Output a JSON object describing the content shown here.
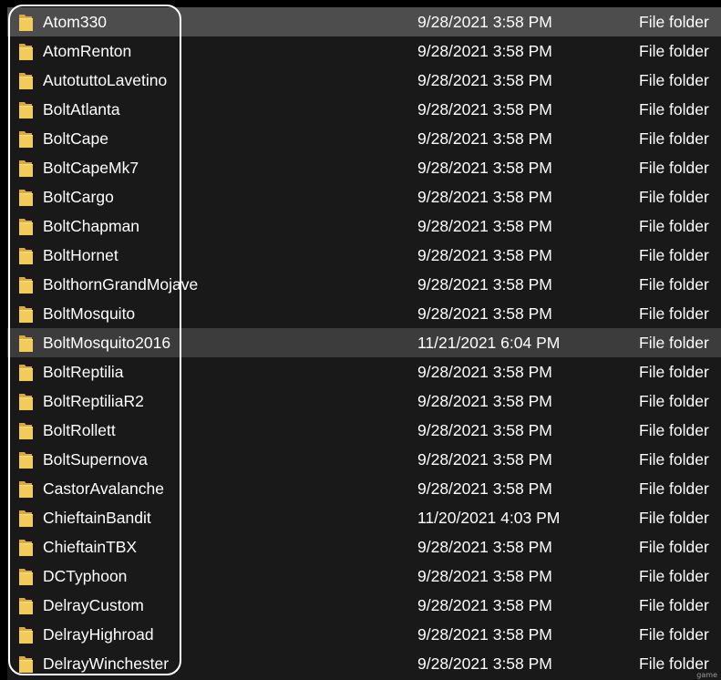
{
  "file_list": {
    "icon": "folder-icon",
    "colors": {
      "background": "#191919",
      "selected_row": "#4d4d4d",
      "hovered_row": "#3c3c3c",
      "text": "#ffffff",
      "folder_yellow": "#f3cb5b",
      "highlight_border": "#ffffff"
    },
    "rows": [
      {
        "name": "Atom330",
        "date": "9/28/2021 3:58 PM",
        "type": "File folder",
        "state": "selected"
      },
      {
        "name": "AtomRenton",
        "date": "9/28/2021 3:58 PM",
        "type": "File folder",
        "state": ""
      },
      {
        "name": "AutotuttoLavetino",
        "date": "9/28/2021 3:58 PM",
        "type": "File folder",
        "state": ""
      },
      {
        "name": "BoltAtlanta",
        "date": "9/28/2021 3:58 PM",
        "type": "File folder",
        "state": ""
      },
      {
        "name": "BoltCape",
        "date": "9/28/2021 3:58 PM",
        "type": "File folder",
        "state": ""
      },
      {
        "name": "BoltCapeMk7",
        "date": "9/28/2021 3:58 PM",
        "type": "File folder",
        "state": ""
      },
      {
        "name": "BoltCargo",
        "date": "9/28/2021 3:58 PM",
        "type": "File folder",
        "state": ""
      },
      {
        "name": "BoltChapman",
        "date": "9/28/2021 3:58 PM",
        "type": "File folder",
        "state": ""
      },
      {
        "name": "BoltHornet",
        "date": "9/28/2021 3:58 PM",
        "type": "File folder",
        "state": ""
      },
      {
        "name": "BolthornGrandMojave",
        "date": "9/28/2021 3:58 PM",
        "type": "File folder",
        "state": ""
      },
      {
        "name": "BoltMosquito",
        "date": "9/28/2021 3:58 PM",
        "type": "File folder",
        "state": ""
      },
      {
        "name": "BoltMosquito2016",
        "date": "11/21/2021 6:04 PM",
        "type": "File folder",
        "state": "hovered"
      },
      {
        "name": "BoltReptilia",
        "date": "9/28/2021 3:58 PM",
        "type": "File folder",
        "state": ""
      },
      {
        "name": "BoltReptiliaR2",
        "date": "9/28/2021 3:58 PM",
        "type": "File folder",
        "state": ""
      },
      {
        "name": "BoltRollett",
        "date": "9/28/2021 3:58 PM",
        "type": "File folder",
        "state": ""
      },
      {
        "name": "BoltSupernova",
        "date": "9/28/2021 3:58 PM",
        "type": "File folder",
        "state": ""
      },
      {
        "name": "CastorAvalanche",
        "date": "9/28/2021 3:58 PM",
        "type": "File folder",
        "state": ""
      },
      {
        "name": "ChieftainBandit",
        "date": "11/20/2021 4:03 PM",
        "type": "File folder",
        "state": ""
      },
      {
        "name": "ChieftainTBX",
        "date": "9/28/2021 3:58 PM",
        "type": "File folder",
        "state": ""
      },
      {
        "name": "DCTyphoon",
        "date": "9/28/2021 3:58 PM",
        "type": "File folder",
        "state": ""
      },
      {
        "name": "DelrayCustom",
        "date": "9/28/2021 3:58 PM",
        "type": "File folder",
        "state": ""
      },
      {
        "name": "DelrayHighroad",
        "date": "9/28/2021 3:58 PM",
        "type": "File folder",
        "state": ""
      },
      {
        "name": "DelrayWinchester",
        "date": "9/28/2021 3:58 PM",
        "type": "File folder",
        "state": ""
      }
    ]
  },
  "watermark": {
    "text": "game"
  }
}
